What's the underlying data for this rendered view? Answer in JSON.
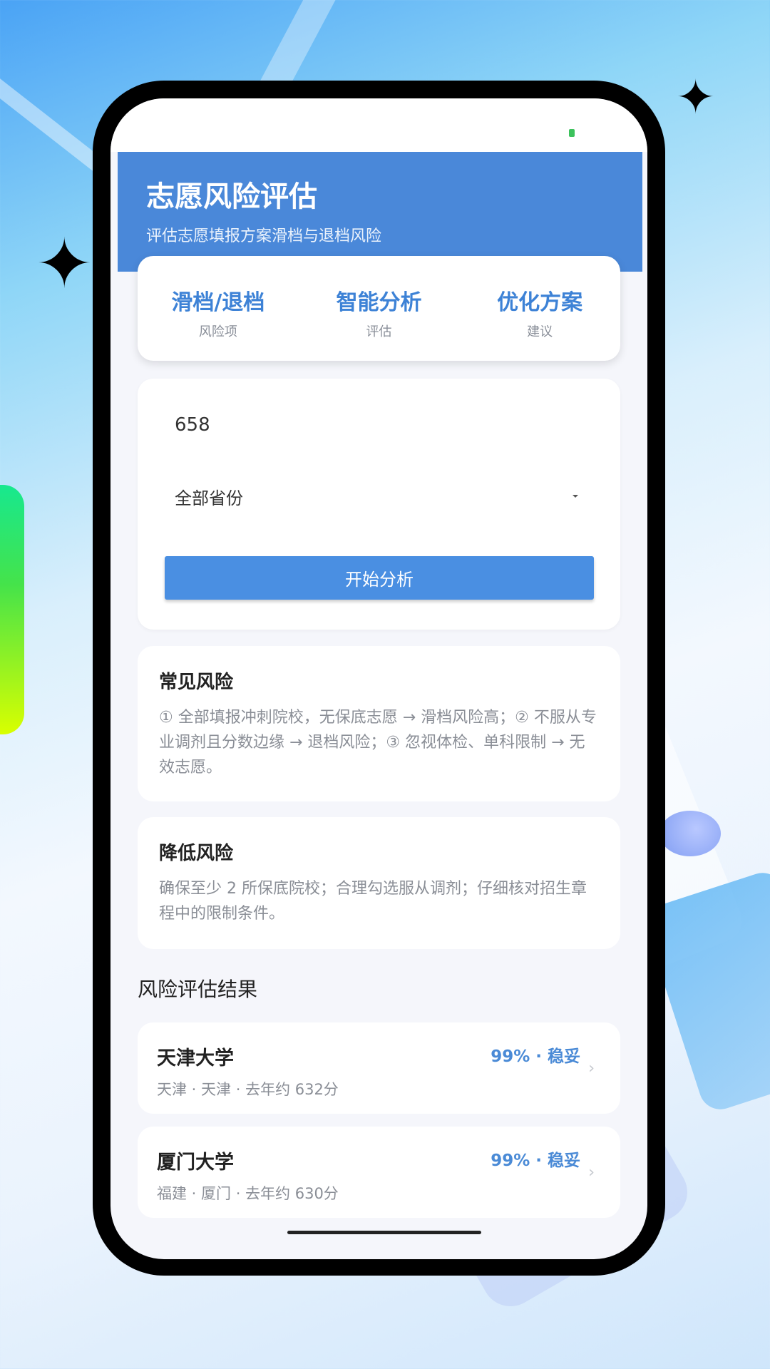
{
  "header": {
    "title": "志愿风险评估",
    "subtitle": "评估志愿填报方案滑档与退档风险"
  },
  "features": [
    {
      "title": "滑档/退档",
      "sub": "风险项"
    },
    {
      "title": "智能分析",
      "sub": "评估"
    },
    {
      "title": "优化方案",
      "sub": "建议"
    }
  ],
  "form": {
    "score_value": "658",
    "province_selected": "全部省份",
    "submit_label": "开始分析"
  },
  "tips": [
    {
      "title": "常见风险",
      "text": "① 全部填报冲刺院校，无保底志愿 → 滑档风险高；② 不服从专业调剂且分数边缘 → 退档风险；③ 忽视体检、单科限制 → 无效志愿。"
    },
    {
      "title": "降低风险",
      "text": "确保至少 2 所保底院校；合理勾选服从调剂；仔细核对招生章程中的限制条件。"
    }
  ],
  "results": {
    "title": "风险评估结果",
    "items": [
      {
        "name": "天津大学",
        "meta": "天津 · 天津 · 去年约 632分",
        "score": "99% · 稳妥"
      },
      {
        "name": "厦门大学",
        "meta": "福建 · 厦门 · 去年约 630分",
        "score": "99% · 稳妥"
      }
    ]
  },
  "icons": {
    "dropdown": "caret-down-icon",
    "chevron": "chevron-right-icon",
    "sparkle": "sparkle-icon"
  },
  "colors": {
    "accent": "#4a88d9",
    "button": "#4a8fe2",
    "score_text": "#4a8ad6",
    "battery": "#3cc25c"
  }
}
